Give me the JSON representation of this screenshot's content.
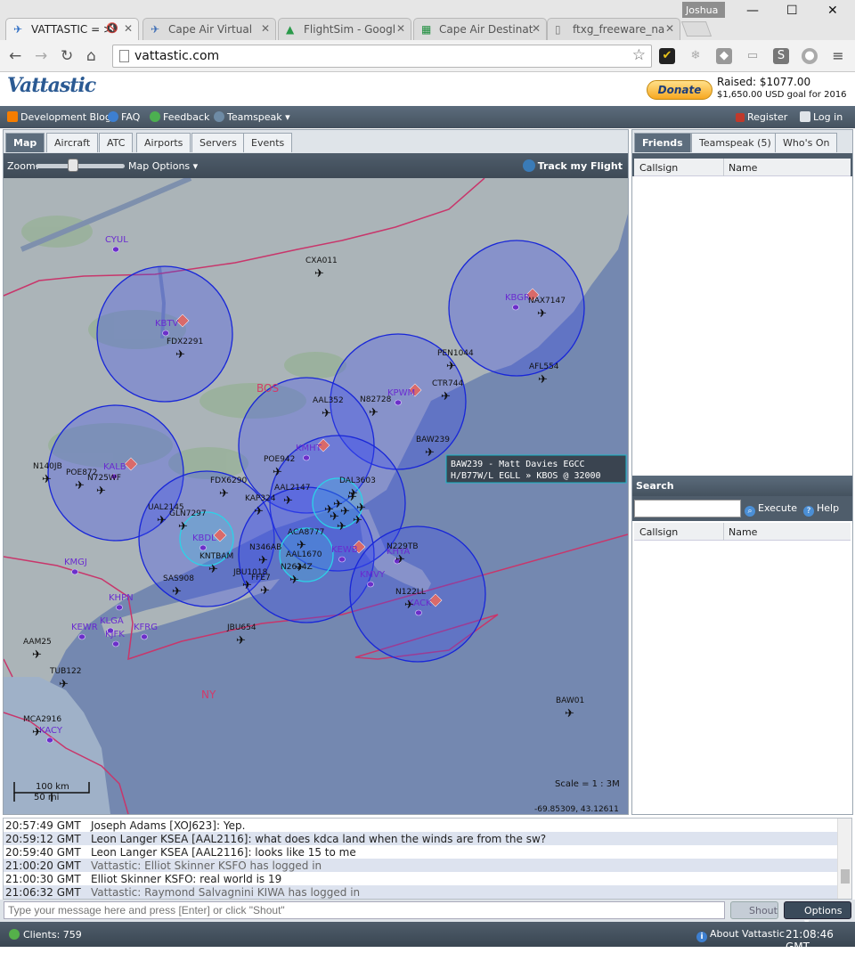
{
  "browser": {
    "tabs": [
      {
        "title": "VATTASTIC = >",
        "icon": "vattastic-favicon",
        "muted": true
      },
      {
        "title": "Cape Air Virtual",
        "icon": "cape-air-favicon"
      },
      {
        "title": "FlightSim - Googl",
        "icon": "google-drive-favicon"
      },
      {
        "title": "Cape Air Destinat",
        "icon": "google-sheets-favicon"
      },
      {
        "title": "ftxg_freeware_na",
        "icon": "document-favicon"
      }
    ],
    "profile": "Joshua",
    "url": "vattastic.com"
  },
  "site": {
    "logo": "Vattastic",
    "donate_label": "Donate",
    "raised": "Raised: $1077.00",
    "goal": "$1,650.00 USD goal for 2016",
    "menu": {
      "blog": "Development Blog",
      "faq": "FAQ",
      "feedback": "Feedback",
      "teamspeak": "Teamspeak",
      "register": "Register",
      "login": "Log in"
    }
  },
  "left_tabs": [
    "Map",
    "Aircraft",
    "ATC",
    "Airports",
    "Servers",
    "Events"
  ],
  "map_toolbar": {
    "zoom_label": "Zoom:",
    "map_options": "Map Options",
    "track": "Track my Flight"
  },
  "map": {
    "region_label": "BOS",
    "ny_label": "NY",
    "airports": [
      {
        "code": "CYUL"
      },
      {
        "code": "KBTV"
      },
      {
        "code": "KALB"
      },
      {
        "code": "KBDL"
      },
      {
        "code": "KPWM"
      },
      {
        "code": "KBGR"
      },
      {
        "code": "KMHT"
      },
      {
        "code": "KEWB"
      },
      {
        "code": "KMVY"
      },
      {
        "code": "KACK"
      },
      {
        "code": "KHYA"
      },
      {
        "code": "KMGJ"
      },
      {
        "code": "KHPN"
      },
      {
        "code": "KLGA"
      },
      {
        "code": "KJFK"
      },
      {
        "code": "KEWR"
      },
      {
        "code": "KFRG"
      },
      {
        "code": "KACY"
      }
    ],
    "aircraft": [
      {
        "callsign": "CXA011"
      },
      {
        "callsign": "FDX2291"
      },
      {
        "callsign": "NAX7147"
      },
      {
        "callsign": "PEN1044"
      },
      {
        "callsign": "AFL554"
      },
      {
        "callsign": "CTR744"
      },
      {
        "callsign": "AAL352"
      },
      {
        "callsign": "N82728"
      },
      {
        "callsign": "BAW239"
      },
      {
        "callsign": "N140JB"
      },
      {
        "callsign": "POE872"
      },
      {
        "callsign": "N725WF"
      },
      {
        "callsign": "POE942"
      },
      {
        "callsign": "FDX6290"
      },
      {
        "callsign": "KAP324"
      },
      {
        "callsign": "AAL2147"
      },
      {
        "callsign": "DAL3603"
      },
      {
        "callsign": "UAL2145"
      },
      {
        "callsign": "GLN7297"
      },
      {
        "callsign": "KNTBAM"
      },
      {
        "callsign": "ACA8777"
      },
      {
        "callsign": "N346AB"
      },
      {
        "callsign": "AAL1670"
      },
      {
        "callsign": "N2624Z"
      },
      {
        "callsign": "JBU1018"
      },
      {
        "callsign": "FFE7"
      },
      {
        "callsign": "SAS908"
      },
      {
        "callsign": "N229TB"
      },
      {
        "callsign": "N122LL"
      },
      {
        "callsign": "JBU654"
      },
      {
        "callsign": "AAM25"
      },
      {
        "callsign": "TUB122"
      },
      {
        "callsign": "MCA2916"
      },
      {
        "callsign": "BAW01"
      }
    ],
    "tooltip_line1": "BAW239 - Matt Davies EGCC",
    "tooltip_line2": "H/B77W/L EGLL » KBOS @ 32000",
    "scale_km": "100 km",
    "scale_mi": "50 mi",
    "scale_text": "Scale = 1 : 3M",
    "coords": "-69.85309, 43.12611"
  },
  "right_tabs": [
    "Friends",
    "Teamspeak (5)",
    "Who's On"
  ],
  "friends_table": {
    "col1": "Callsign",
    "col2": "Name"
  },
  "search": {
    "title": "Search",
    "execute": "Execute",
    "help": "Help",
    "col1": "Callsign",
    "col2": "Name"
  },
  "chat": {
    "messages": [
      {
        "time": "20:57:49 GMT",
        "text": "Joseph Adams [XOJ623]: Yep.",
        "system": false
      },
      {
        "time": "20:59:12 GMT",
        "text": "Leon Langer KSEA [AAL2116]: what does kdca land when the winds are from the sw?",
        "system": false
      },
      {
        "time": "20:59:40 GMT",
        "text": "Leon Langer KSEA [AAL2116]: looks like 15 to me",
        "system": false
      },
      {
        "time": "21:00:20 GMT",
        "text": "Vattastic: Elliot Skinner KSFO has logged in",
        "system": true
      },
      {
        "time": "21:00:30 GMT",
        "text": "Elliot Skinner KSFO: real world is 19",
        "system": false
      },
      {
        "time": "21:06:32 GMT",
        "text": "Vattastic: Raymond Salvagnini KIWA has logged in",
        "system": true
      }
    ],
    "input_placeholder": "Type your message here and press [Enter] or click \"Shout\"",
    "shout": "Shout",
    "options": "Options"
  },
  "status": {
    "clients": "Clients: 759",
    "about": "About Vattastic",
    "clock": "21:08:46 GMT"
  },
  "colors": {
    "ocean": "#7488b0",
    "land": "#aab3b8",
    "atc_circle": "#3a4cf0",
    "boundary": "#c8366b",
    "header_bar": "#4f5d6b"
  }
}
